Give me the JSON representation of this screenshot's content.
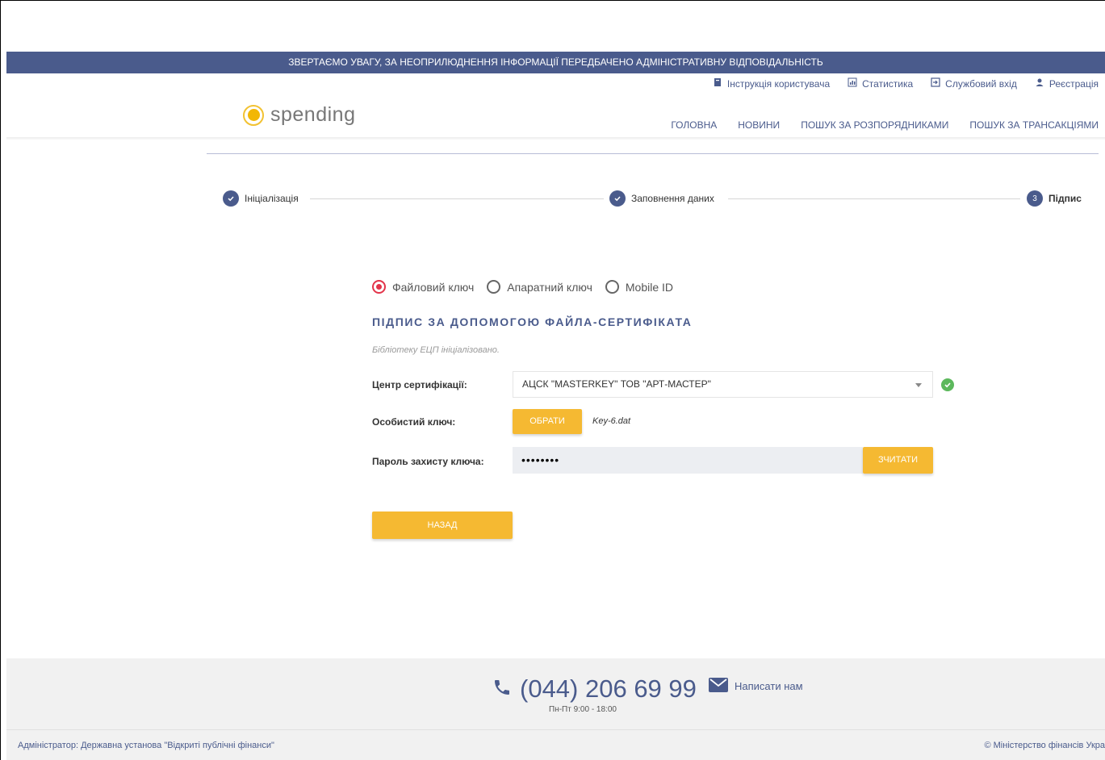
{
  "banner": {
    "text": "ЗВЕРТАЄМО УВАГУ, ЗА НЕОПРИЛЮДНЕННЯ ІНФОРМАЦІЇ ПЕРЕДБАЧЕНО АДМІНІСТРАТИВНУ ВІДПОВІДАЛЬНІСТЬ"
  },
  "top_links": [
    {
      "label": "Інструкція користувача",
      "icon": "book-icon"
    },
    {
      "label": "Статистика",
      "icon": "chart-icon"
    },
    {
      "label": "Службовий вхід",
      "icon": "login-icon"
    },
    {
      "label": "Реєстрація",
      "icon": "user-add-icon"
    }
  ],
  "logo": {
    "text": "spending"
  },
  "nav": [
    "ГОЛОВНА",
    "НОВИНИ",
    "ПОШУК ЗА РОЗПОРЯДНИКАМИ",
    "ПОШУК ЗА ТРАНСАКЦІЯМИ"
  ],
  "steps": [
    {
      "label": "Ініціалізація",
      "state": "done"
    },
    {
      "label": "Заповнення даних",
      "state": "done"
    },
    {
      "label": "Підпис",
      "number": "3",
      "state": "current"
    }
  ],
  "key_types": [
    {
      "label": "Файловий ключ",
      "checked": true
    },
    {
      "label": "Апаратний ключ",
      "checked": false
    },
    {
      "label": "Mobile ID",
      "checked": false
    }
  ],
  "form": {
    "title": "ПІДПИС ЗА ДОПОМОГОЮ ФАЙЛА-СЕРТИФІКАТА",
    "status": "Бібліотеку ЕЦП ініціалізовано.",
    "ca_label": "Центр сертифікації:",
    "ca_value": "АЦСК \"MASTERKEY\" ТОВ \"АРТ-МАСТЕР\"",
    "key_label": "Особистий ключ:",
    "choose_button": "ОБРАТИ",
    "key_file": "Key-6.dat",
    "password_label": "Пароль захисту ключа:",
    "password_value": "••••••••",
    "read_button": "ЗЧИТАТИ",
    "back_button": "НАЗАД"
  },
  "footer": {
    "phone": "(044) 206 69 99",
    "hours": "Пн-Пт 9:00 - 18:00",
    "write_us": "Написати нам",
    "admin": "Адміністратор: Державна установа \"Відкриті публічні фінанси\"",
    "copyright": "© Міністерство фінансів Укра"
  },
  "colors": {
    "primary": "#4a5b8c",
    "accent": "#f5b932",
    "radio_active": "#e3344a",
    "success": "#5cb85c"
  }
}
